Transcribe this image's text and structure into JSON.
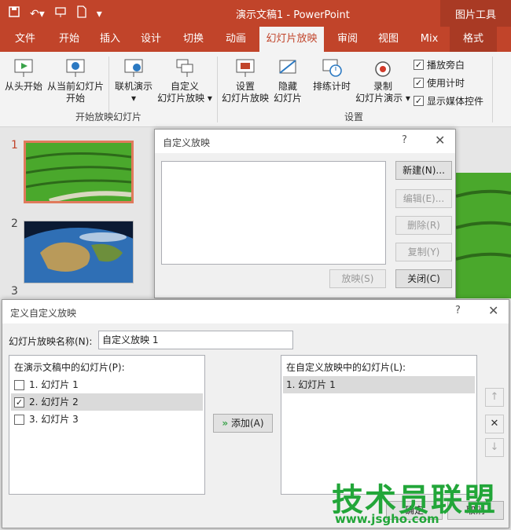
{
  "window": {
    "title": "演示文稿1 - PowerPoint",
    "context_tab_group": "图片工具",
    "qat": {
      "save_icon": "save-icon",
      "undo_icon": "undo-icon",
      "present_icon": "present-icon",
      "new_icon": "new-doc-icon",
      "customize_icon": "customize-qat-icon"
    }
  },
  "tabs": [
    {
      "label": "文件"
    },
    {
      "label": "开始"
    },
    {
      "label": "插入"
    },
    {
      "label": "设计"
    },
    {
      "label": "切换"
    },
    {
      "label": "动画"
    },
    {
      "label": "幻灯片放映"
    },
    {
      "label": "审阅"
    },
    {
      "label": "视图"
    },
    {
      "label": "Mix"
    },
    {
      "label": "格式"
    }
  ],
  "ribbon": {
    "from_beginning": "从头开始",
    "from_current": [
      "从当前幻灯片",
      "开始"
    ],
    "online_present": [
      "联机演示",
      "▾"
    ],
    "custom_show": [
      "自定义",
      "幻灯片放映 ▾"
    ],
    "group_start": "开始放映幻灯片",
    "setup_show": [
      "设置",
      "幻灯片放映"
    ],
    "hide_slide": [
      "隐藏",
      "幻灯片"
    ],
    "rehearse": "排练计时",
    "record": [
      "录制",
      "幻灯片演示 ▾"
    ],
    "group_setup": "设置",
    "play_narration": "播放旁白",
    "use_timings": "使用计时",
    "show_media_controls": "显示媒体控件"
  },
  "slides": [
    {
      "number": "1"
    },
    {
      "number": "2"
    },
    {
      "number": "3"
    }
  ],
  "custom_show_dialog": {
    "title": "自定义放映",
    "help": "?",
    "close": "✕",
    "new_button": "新建(N)...",
    "edit_button": "编辑(E)...",
    "delete_button": "删除(R)",
    "copy_button": "复制(Y)",
    "show_button": "放映(S)",
    "close_button": "关闭(C)"
  },
  "define_dialog": {
    "title": "定义自定义放映",
    "help": "?",
    "close": "✕",
    "name_label": "幻灯片放映名称(N):",
    "name_value": "自定义放映 1",
    "left_label": "在演示文稿中的幻灯片(P):",
    "left_items": [
      {
        "label": "1. 幻灯片 1",
        "checked": ""
      },
      {
        "label": "2. 幻灯片 2",
        "checked": "✓"
      },
      {
        "label": "3. 幻灯片 3",
        "checked": ""
      }
    ],
    "add_button": "添加(A)",
    "right_label": "在自定义放映中的幻灯片(L):",
    "right_items": [
      {
        "label": "1. 幻灯片 1"
      }
    ],
    "up_icon": "↑",
    "remove_icon": "✕",
    "down_icon": "↓",
    "ok_button": "确定",
    "cancel_button": "取消"
  },
  "watermark": {
    "text": "技术员联盟",
    "url": "www.jsgho.com"
  },
  "colors": {
    "accent": "#c1442a",
    "watermark": "#22a639"
  }
}
